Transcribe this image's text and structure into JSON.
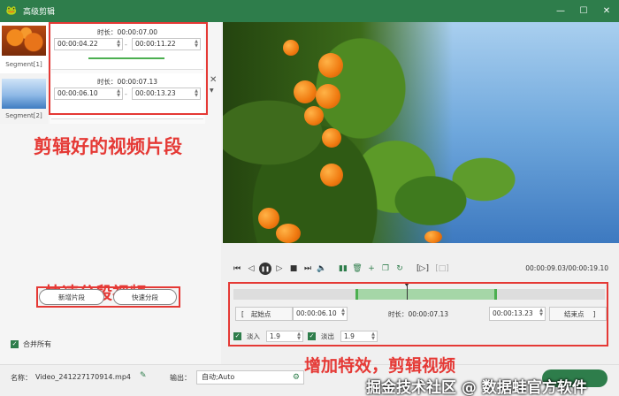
{
  "window": {
    "title": "高级剪辑",
    "minimize": "—",
    "maximize": "☐",
    "close": "✕"
  },
  "segments": [
    {
      "label": "Segment[1]",
      "duration_label": "时长：",
      "duration": "00:00:07.00",
      "start": "00:00:04.22",
      "end": "00:00:11.22"
    },
    {
      "label": "Segment[2]",
      "duration_label": "时长：",
      "duration": "00:00:07.13",
      "start": "00:00:06.10",
      "end": "00:00:13.23"
    }
  ],
  "segment_separator": "-",
  "annotations": {
    "clipped": "剪辑好的视频片段",
    "quick_split": "快速分段视频",
    "effects": "增加特效，剪辑视频"
  },
  "buttons": {
    "new_segment": "新增片段",
    "quick_split": "快速分段",
    "start_point": "起始点",
    "end_point": "结束点"
  },
  "merge_all": "合并所有",
  "player": {
    "time": "00:00:09.03/00:00:19.10"
  },
  "trim": {
    "start": "00:00:06.10",
    "duration_label": "时长：",
    "duration": "00:00:07.13",
    "end": "00:00:13.23",
    "bracket_left": "[",
    "bracket_right": "]"
  },
  "fade": {
    "in_label": "淡入",
    "in_value": "1.9",
    "out_label": "淡出",
    "out_value": "1.9"
  },
  "bottom": {
    "name_label": "名称：",
    "file_name": "Video_241227170914.mp4",
    "output_label": "输出：",
    "output_value": "自动;Auto"
  },
  "watermark": "掘金技术社区 @ 数据蛙官方软件",
  "colors": {
    "accent": "#2e7d4b",
    "annotation": "#e53935",
    "selection": "#a5d6a7"
  }
}
